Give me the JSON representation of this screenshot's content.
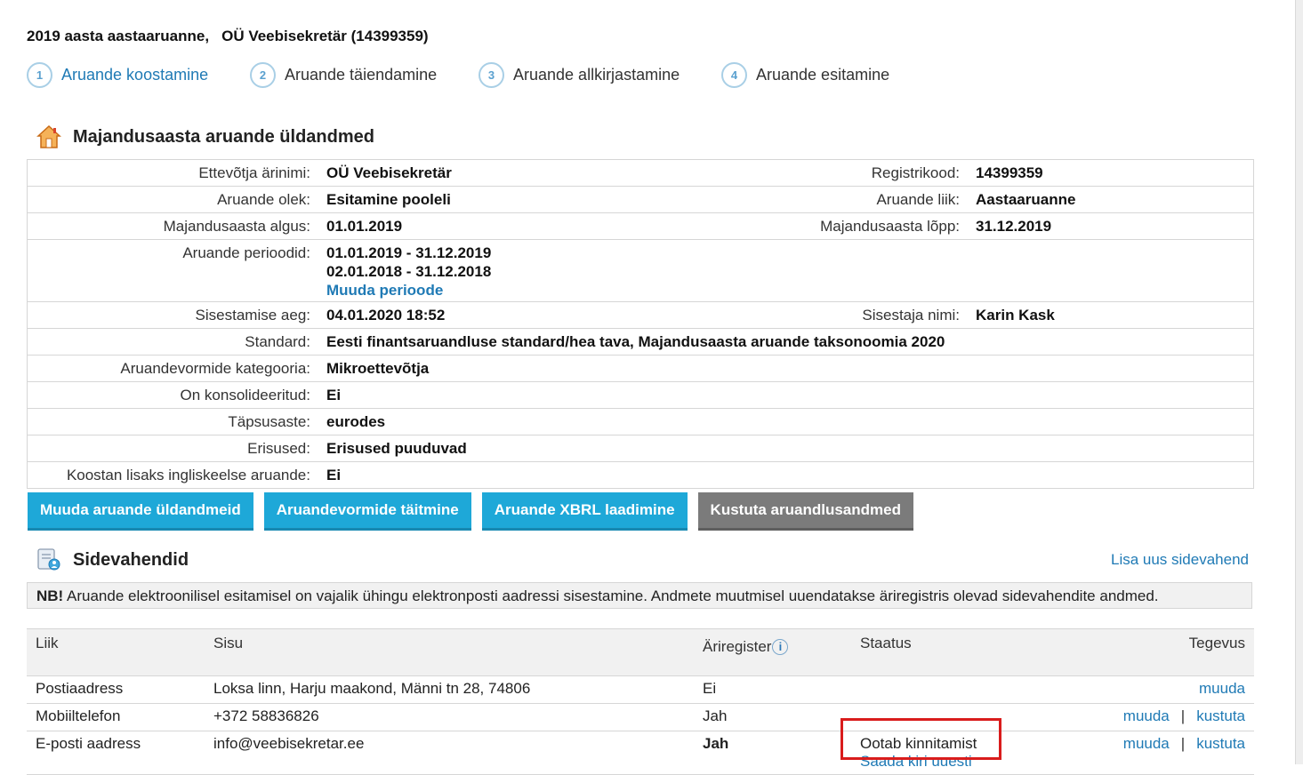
{
  "title": {
    "report": "2019 aasta aastaaruanne,",
    "company": "OÜ Veebisekretär (14399359)"
  },
  "steps": [
    {
      "num": "1",
      "label": "Aruande koostamine",
      "active": true
    },
    {
      "num": "2",
      "label": "Aruande täiendamine",
      "active": false
    },
    {
      "num": "3",
      "label": "Aruande allkirjastamine",
      "active": false
    },
    {
      "num": "4",
      "label": "Aruande esitamine",
      "active": false
    }
  ],
  "general": {
    "heading": "Majandusaasta aruande üldandmed",
    "icon": "house-icon",
    "rows": {
      "name_label": "Ettevõtja ärinimi:",
      "name": "OÜ Veebisekretär",
      "regcode_label": "Registrikood:",
      "regcode": "14399359",
      "status_label": "Aruande olek:",
      "status": "Esitamine pooleli",
      "type_label": "Aruande liik:",
      "type": "Aastaaruanne",
      "start_label": "Majandusaasta algus:",
      "start": "01.01.2019",
      "end_label": "Majandusaasta lõpp:",
      "end": "31.12.2019",
      "periods_label": "Aruande perioodid:",
      "period1": "01.01.2019 - 31.12.2019",
      "period2": "02.01.2018 - 31.12.2018",
      "change_periods": "Muuda perioode",
      "entered_label": "Sisestamise aeg:",
      "entered": "04.01.2020 18:52",
      "enterer_label": "Sisestaja nimi:",
      "enterer": "Karin Kask",
      "standard_label": "Standard:",
      "standard": "Eesti finantsaruandluse standard/hea tava, Majandusaasta aruande taksonoomia 2020",
      "category_label": "Aruandevormide kategooria:",
      "category": "Mikroettevõtja",
      "consolidated_label": "On konsolideeritud:",
      "consolidated": "Ei",
      "precision_label": "Täpsusaste:",
      "precision": "eurodes",
      "exceptions_label": "Erisused:",
      "exceptions": "Erisused puuduvad",
      "english_label": "Koostan lisaks ingliskeelse aruande:",
      "english": "Ei"
    }
  },
  "buttons": {
    "edit": "Muuda aruande üldandmeid",
    "forms": "Aruandevormide täitmine",
    "xbrl": "Aruande XBRL laadimine",
    "delete": "Kustuta aruandlusandmed"
  },
  "contacts": {
    "heading": "Sidevahendid",
    "icon": "contacts-icon",
    "add_link": "Lisa uus sidevahend",
    "notice_bold": "NB!",
    "notice_text": " Aruande elektroonilisel esitamisel on vajalik ühingu elektronposti aadressi sisestamine. Andmete muutmisel uuendatakse äriregistris olevad sidevahendite andmed.",
    "columns": {
      "kind": "Liik",
      "content": "Sisu",
      "registry": "Äriregister",
      "status": "Staatus",
      "actions": "Tegevus"
    },
    "rows": [
      {
        "kind": "Postiaadress",
        "content": "Loksa linn, Harju maakond, Männi tn 28, 74806",
        "registry": "Ei",
        "status": "",
        "resend": "",
        "edit": "muuda",
        "delete": ""
      },
      {
        "kind": "Mobiiltelefon",
        "content": "+372 58836826",
        "registry": "Jah",
        "status": "",
        "resend": "",
        "edit": "muuda",
        "delete": "kustuta"
      },
      {
        "kind": "E-posti aadress",
        "content": "info@veebisekretar.ee",
        "registry": "Jah",
        "status": "Ootab kinnitamist",
        "resend": "Saada kiri uuesti",
        "edit": "muuda",
        "delete": "kustuta"
      }
    ],
    "separator": "|"
  },
  "colors": {
    "accent": "#1ea8d8",
    "link": "#1f7ab5",
    "highlight": "#d91c1c",
    "gray_button": "#7b7b7b"
  }
}
